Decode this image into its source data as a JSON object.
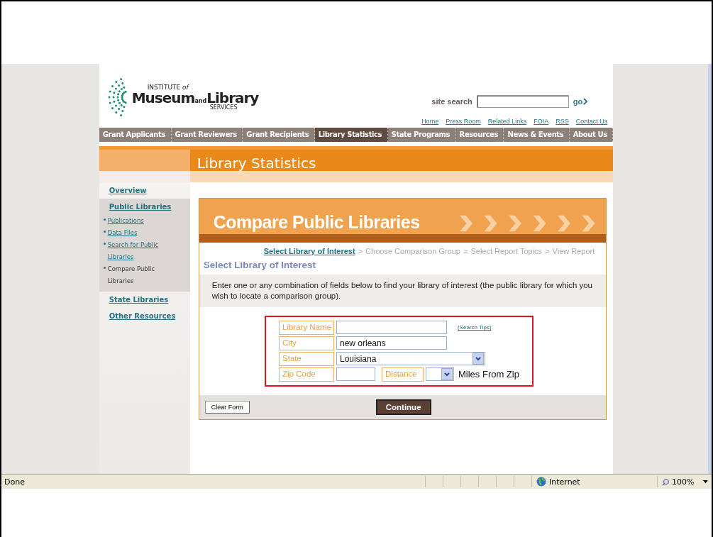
{
  "logo": {
    "top": "INSTITUTE",
    "of": "of",
    "left": "Museum",
    "and": "and",
    "right": "Library",
    "bottom": "SERVICES"
  },
  "site_search": {
    "label": "site search",
    "go": "go"
  },
  "top_links": [
    "Home",
    "Press Room",
    "Related Links",
    "FOIA",
    "RSS",
    "Contact Us"
  ],
  "nav": [
    {
      "label": "Grant Applicants",
      "selected": false
    },
    {
      "label": "Grant Reviewers",
      "selected": false
    },
    {
      "label": "Grant Recipients",
      "selected": false
    },
    {
      "label": "Library Statistics",
      "selected": true
    },
    {
      "label": "State Programs",
      "selected": false
    },
    {
      "label": "Resources",
      "selected": false
    },
    {
      "label": "News & Events",
      "selected": false
    },
    {
      "label": "About Us",
      "selected": false
    }
  ],
  "banner": {
    "title": "Library Statistics"
  },
  "sidebar": [
    {
      "label": "Overview"
    },
    {
      "label": "Public Libraries",
      "children": [
        {
          "label": "Publications",
          "selected": false
        },
        {
          "label": "Data Files",
          "selected": false
        },
        {
          "label": "Search for Public Libraries",
          "selected": false
        },
        {
          "label": "Compare Public Libraries",
          "selected": true
        }
      ]
    },
    {
      "label": "State Libraries"
    },
    {
      "label": "Other Resources"
    }
  ],
  "panel": {
    "title": "Compare Public Libraries",
    "steps": [
      {
        "label": "Select Library of Interest",
        "selected": true
      },
      {
        "label": "Choose Comparison Group",
        "selected": false
      },
      {
        "label": "Select Report Topics",
        "selected": false
      },
      {
        "label": "View Report",
        "selected": false
      }
    ],
    "separator": ">",
    "heading": "Select Library of Interest",
    "instructions": "Enter one or any combination of fields below to find your library of interest (the public library for which you wish to locate a comparison group).",
    "fields": [
      {
        "kind": "text",
        "label": "Library Name",
        "link": "(Search Tips)"
      },
      {
        "kind": "text",
        "label": "City",
        "value": "new orleans"
      },
      {
        "kind": "select",
        "label": "State",
        "value": "Louisiana"
      },
      {
        "kind": "zip",
        "label": "Zip Code",
        "distance_label": "Distance",
        "suffix": "Miles From Zip"
      }
    ],
    "clear_button": "Clear Form",
    "continue_button": "Continue"
  },
  "status_bar": {
    "status": "Done",
    "zone": "Internet",
    "zoom": "100%"
  }
}
